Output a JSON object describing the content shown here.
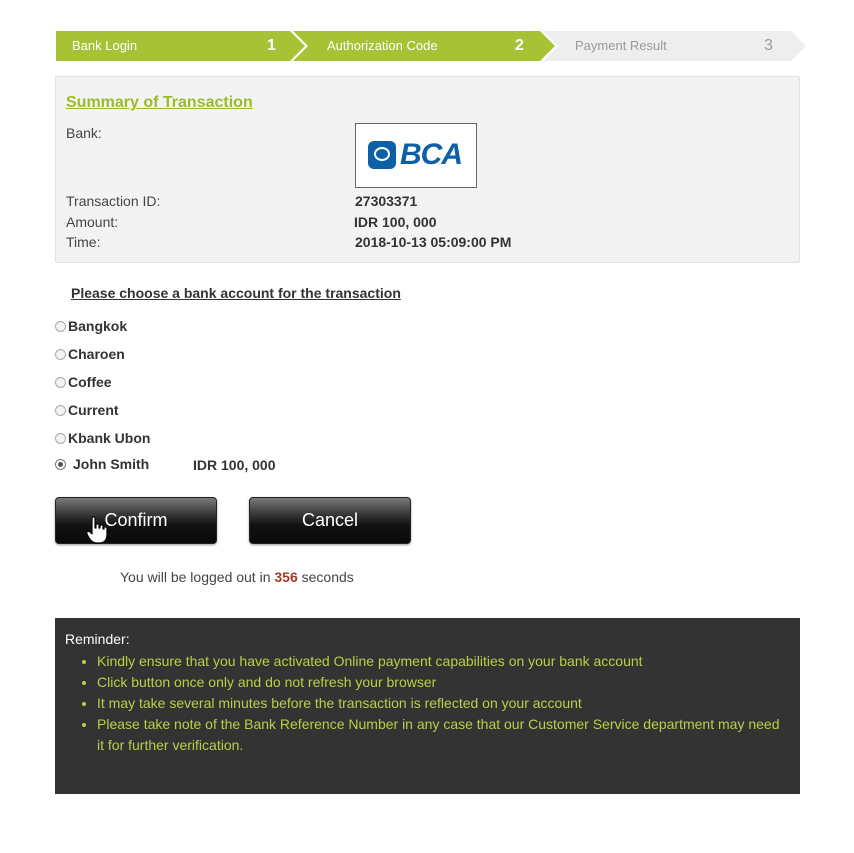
{
  "steps": [
    {
      "label": "Bank Login",
      "number": "1"
    },
    {
      "label": "Authorization Code",
      "number": "2"
    },
    {
      "label": "Payment Result",
      "number": "3"
    }
  ],
  "colors": {
    "active_step": "#a8c236",
    "inactive_step": "#eeeeee",
    "accent": "#9bbb2a",
    "reminder_bg": "#333333"
  },
  "summary": {
    "title": "Summary of Transaction",
    "bank_label": "Bank:",
    "bank_logo_text": "BCA",
    "transaction_id_label": "Transaction ID:",
    "transaction_id": "27303371",
    "amount_label": "Amount:",
    "amount": "IDR 100, 000",
    "time_label": "Time:",
    "time": "2018-10-13 05:09:00 PM"
  },
  "accounts": {
    "title": "Please choose a bank account for the transaction",
    "items": [
      {
        "name": "Bangkok",
        "selected": false
      },
      {
        "name": "Charoen",
        "selected": false
      },
      {
        "name": "Coffee",
        "selected": false
      },
      {
        "name": "Current",
        "selected": false
      },
      {
        "name": "Kbank Ubon",
        "selected": false
      },
      {
        "name": "John Smith",
        "selected": true,
        "amount": "IDR 100, 000"
      }
    ]
  },
  "buttons": {
    "confirm": "Confirm",
    "cancel": "Cancel"
  },
  "logout": {
    "prefix": "You will be logged out in",
    "seconds": "356",
    "suffix": "seconds"
  },
  "reminder": {
    "title": "Reminder:",
    "items": [
      "Kindly ensure that you have activated Online payment capabilities on your bank account",
      "Click button once only and do not refresh your browser",
      "It may take several minutes before the transaction is reflected on your account",
      "Please take note of the Bank Reference Number in any case that our Customer Service department may need it for further verification."
    ]
  }
}
